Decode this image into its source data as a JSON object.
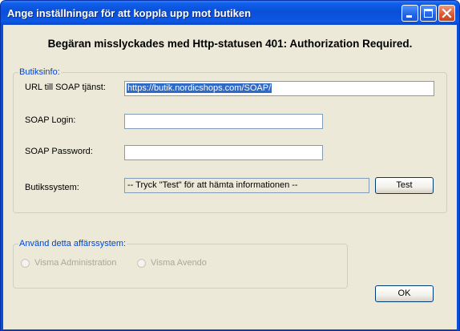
{
  "window": {
    "title": "Ange inställningar för att koppla upp mot butiken",
    "controls": [
      "minimize-icon",
      "maximize-icon",
      "close-icon"
    ]
  },
  "message": "Begäran misslyckades med Http-statusen 401: Authorization Required.",
  "shop_info": {
    "legend": "Butiksinfo:",
    "url_label": "URL till SOAP tjänst:",
    "url_value": "https://butik.nordicshops.com/SOAP/",
    "login_label": "SOAP Login:",
    "login_value": "",
    "password_label": "SOAP Password:",
    "password_value": "",
    "system_label": "Butikssystem:",
    "system_value": "-- Tryck \"Test\" för att hämta informationen --",
    "test_button": "Test"
  },
  "business_system": {
    "legend": "Använd detta affärssystem:",
    "options": [
      "Visma Administration",
      "Visma Avendo"
    ],
    "enabled": false
  },
  "ok_button": "OK",
  "colors": {
    "titlebar": "#0a4fd8",
    "dialog_bg": "#ece9d8",
    "group_legend": "#0046d5",
    "selection": "#316ac5",
    "disabled_text": "#aca899"
  }
}
